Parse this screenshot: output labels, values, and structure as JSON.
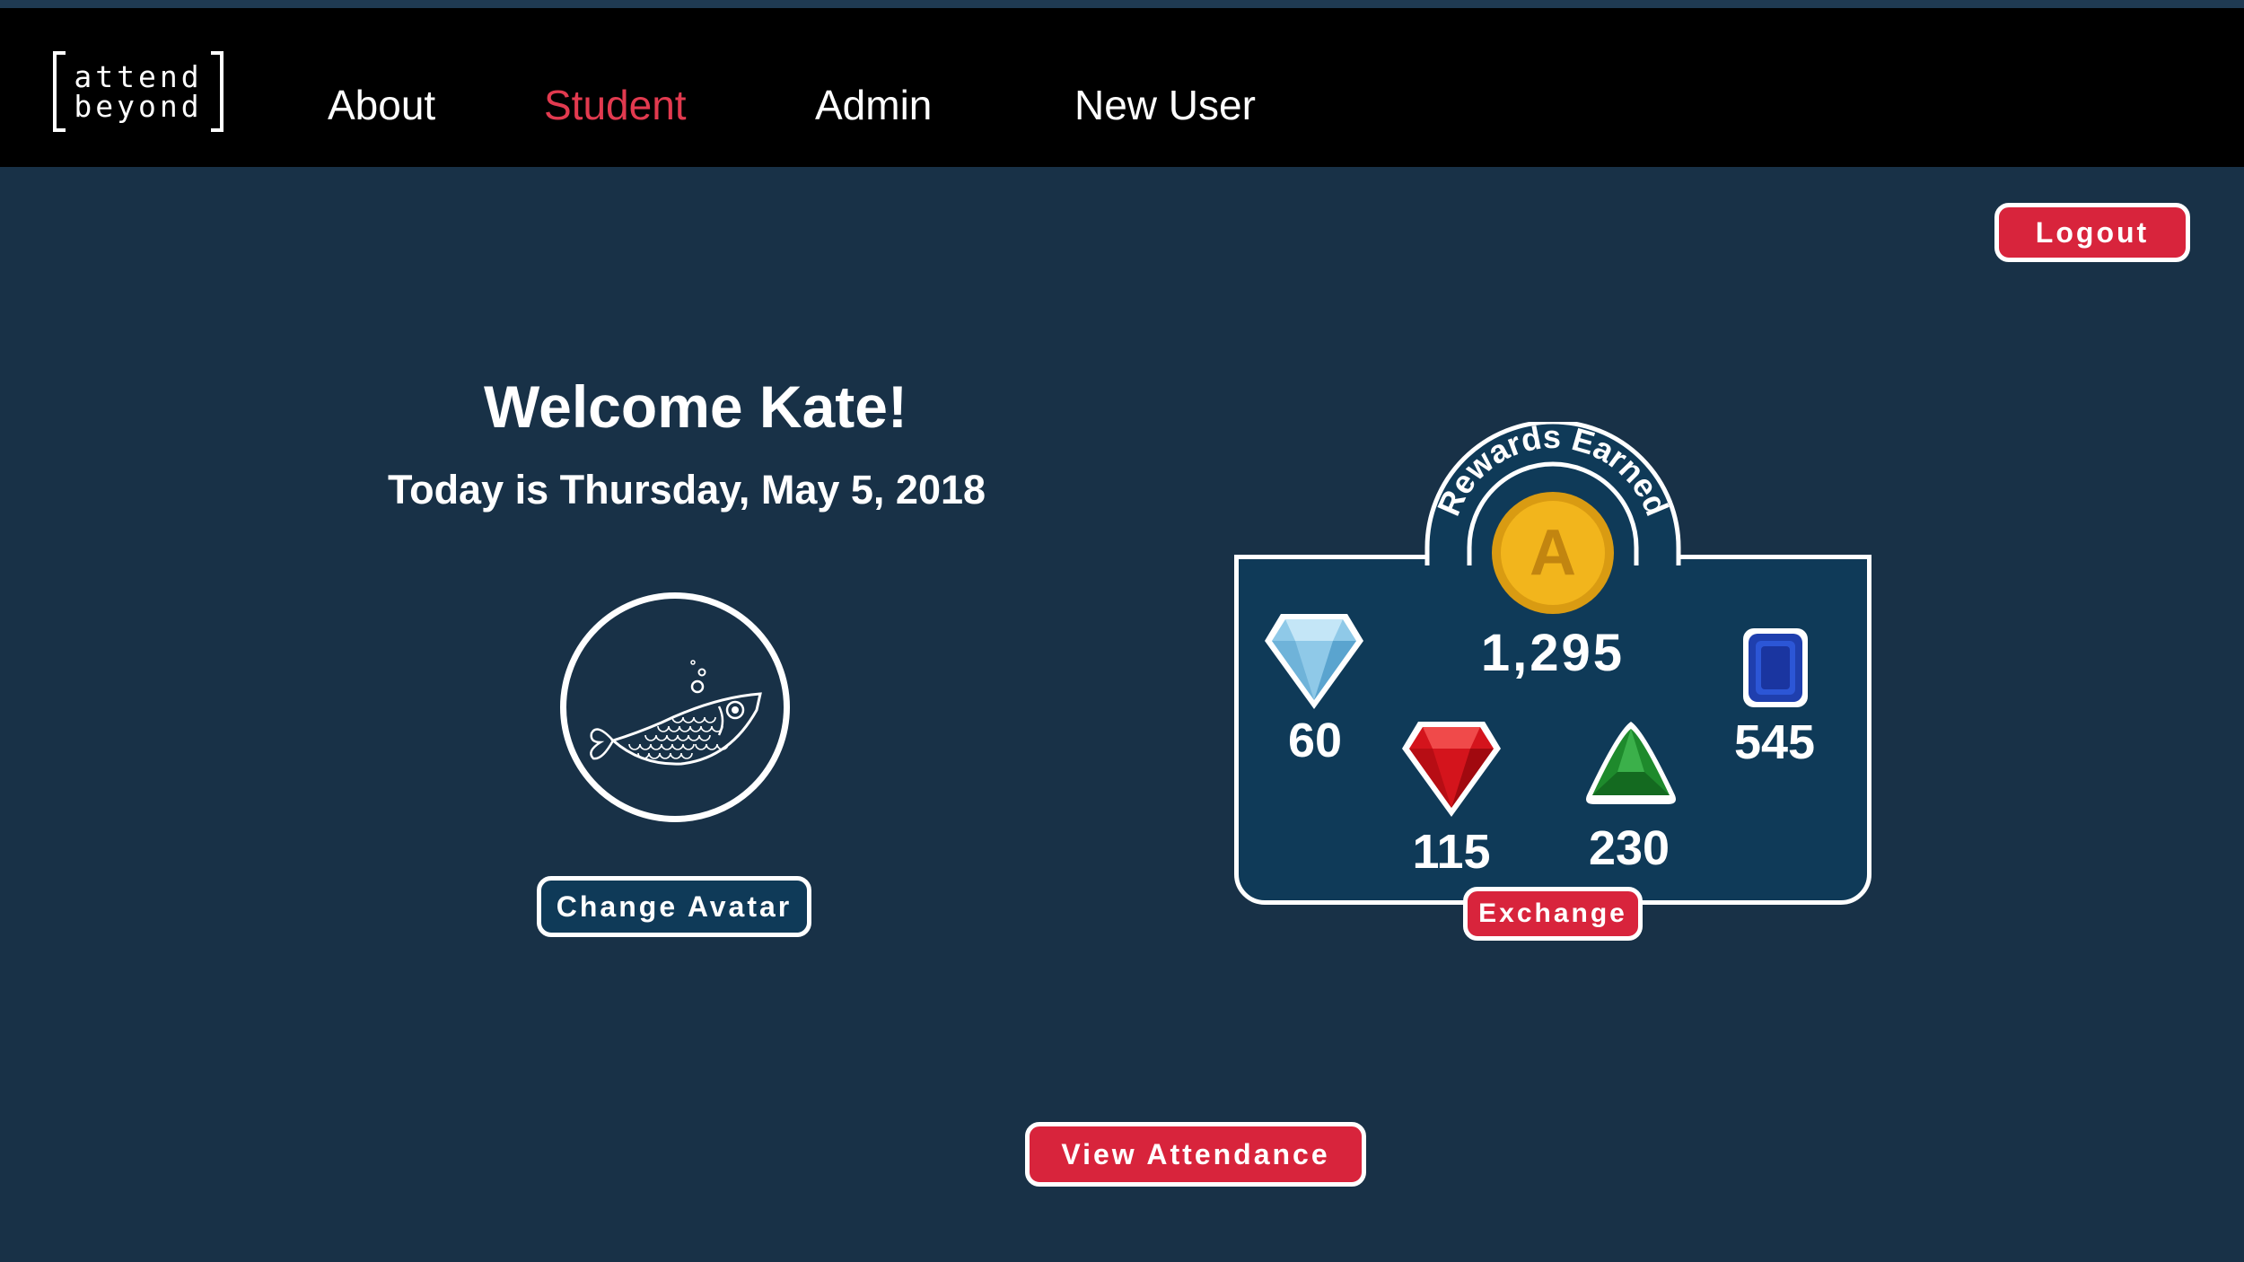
{
  "logo": {
    "line1": "attend",
    "line2": "beyond"
  },
  "nav": {
    "about": "About",
    "student": "Student",
    "admin": "Admin",
    "new_user": "New User"
  },
  "header": {
    "logout": "Logout"
  },
  "main": {
    "welcome": "Welcome Kate!",
    "today": "Today is Thursday, May 5, 2018",
    "change_avatar": "Change Avatar",
    "view_attendance": "View Attendance"
  },
  "rewards": {
    "title": "Rewards Earned",
    "coin_letter": "A",
    "coin_total": "1,295",
    "diamond": "60",
    "ruby": "115",
    "emerald": "230",
    "sapphire": "545",
    "exchange": "Exchange"
  },
  "colors": {
    "background": "#183147",
    "navbar": "#000000",
    "accent_red": "#d8243c",
    "active_nav": "#e23a4f",
    "panel": "#0f3a58",
    "coin": "#f2b51c"
  },
  "icons": {
    "avatar": "fish-avatar-icon",
    "coin": "gold-coin-icon",
    "diamond": "diamond-gem-icon",
    "ruby": "ruby-gem-icon",
    "emerald": "emerald-gem-icon",
    "sapphire": "sapphire-gem-icon"
  }
}
